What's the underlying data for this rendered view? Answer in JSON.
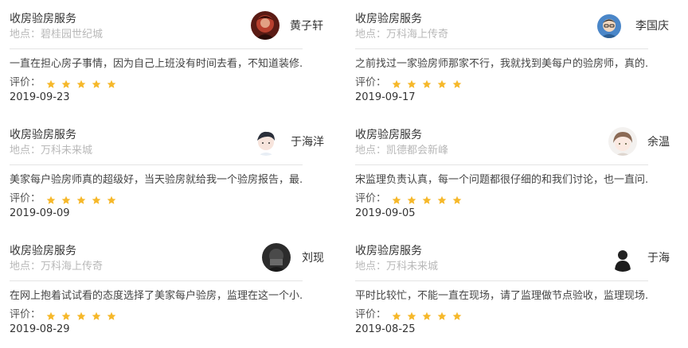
{
  "rating_label": "评价：",
  "star_color": "#f6b82a",
  "reviews": [
    {
      "service": "收房验房服务",
      "location": "地点：碧桂园世纪城",
      "user": "黄子轩",
      "avatar_icon": "user-avatar-red-dark-photo",
      "review": "一直在担心房子事情，因为自己上班没有时间去看，不知道装修...",
      "rating": 5,
      "date": "2019-09-23"
    },
    {
      "service": "收房验房服务",
      "location": "地点：万科海上传奇",
      "user": "李国庆",
      "avatar_icon": "user-avatar-cartoon-glasses",
      "review": "之前找过一家验房师那家不行，我就找到美每户的验房师，真的...",
      "rating": 5,
      "date": "2019-09-17"
    },
    {
      "service": "收房验房服务",
      "location": "地点：万科未来城",
      "user": "于海洋",
      "avatar_icon": "user-avatar-anime-boy",
      "review": "美家每户验房师真的超级好，当天验房就给我一个验房报告，最...",
      "rating": 5,
      "date": "2019-09-09"
    },
    {
      "service": "收房验房服务",
      "location": "地点：凯德都会新峰",
      "user": "余温",
      "avatar_icon": "user-avatar-anime-girl",
      "review": "宋监理负责认真，每一个问题都很仔细的和我们讨论，也一直问...",
      "rating": 5,
      "date": "2019-09-05"
    },
    {
      "service": "收房验房服务",
      "location": "地点：万科海上传奇",
      "user": "刘现",
      "avatar_icon": "user-avatar-dark-photo",
      "review": "在网上抱着试试看的态度选择了美家每户验房，监理在这一个小...",
      "rating": 5,
      "date": "2019-08-29"
    },
    {
      "service": "收房验房服务",
      "location": "地点：万科未来城",
      "user": "于海",
      "avatar_icon": "user-avatar-black-silhouette",
      "review": "平时比较忙，不能一直在现场，请了监理做节点验收，监理现场...",
      "rating": 5,
      "date": "2019-08-25"
    }
  ]
}
